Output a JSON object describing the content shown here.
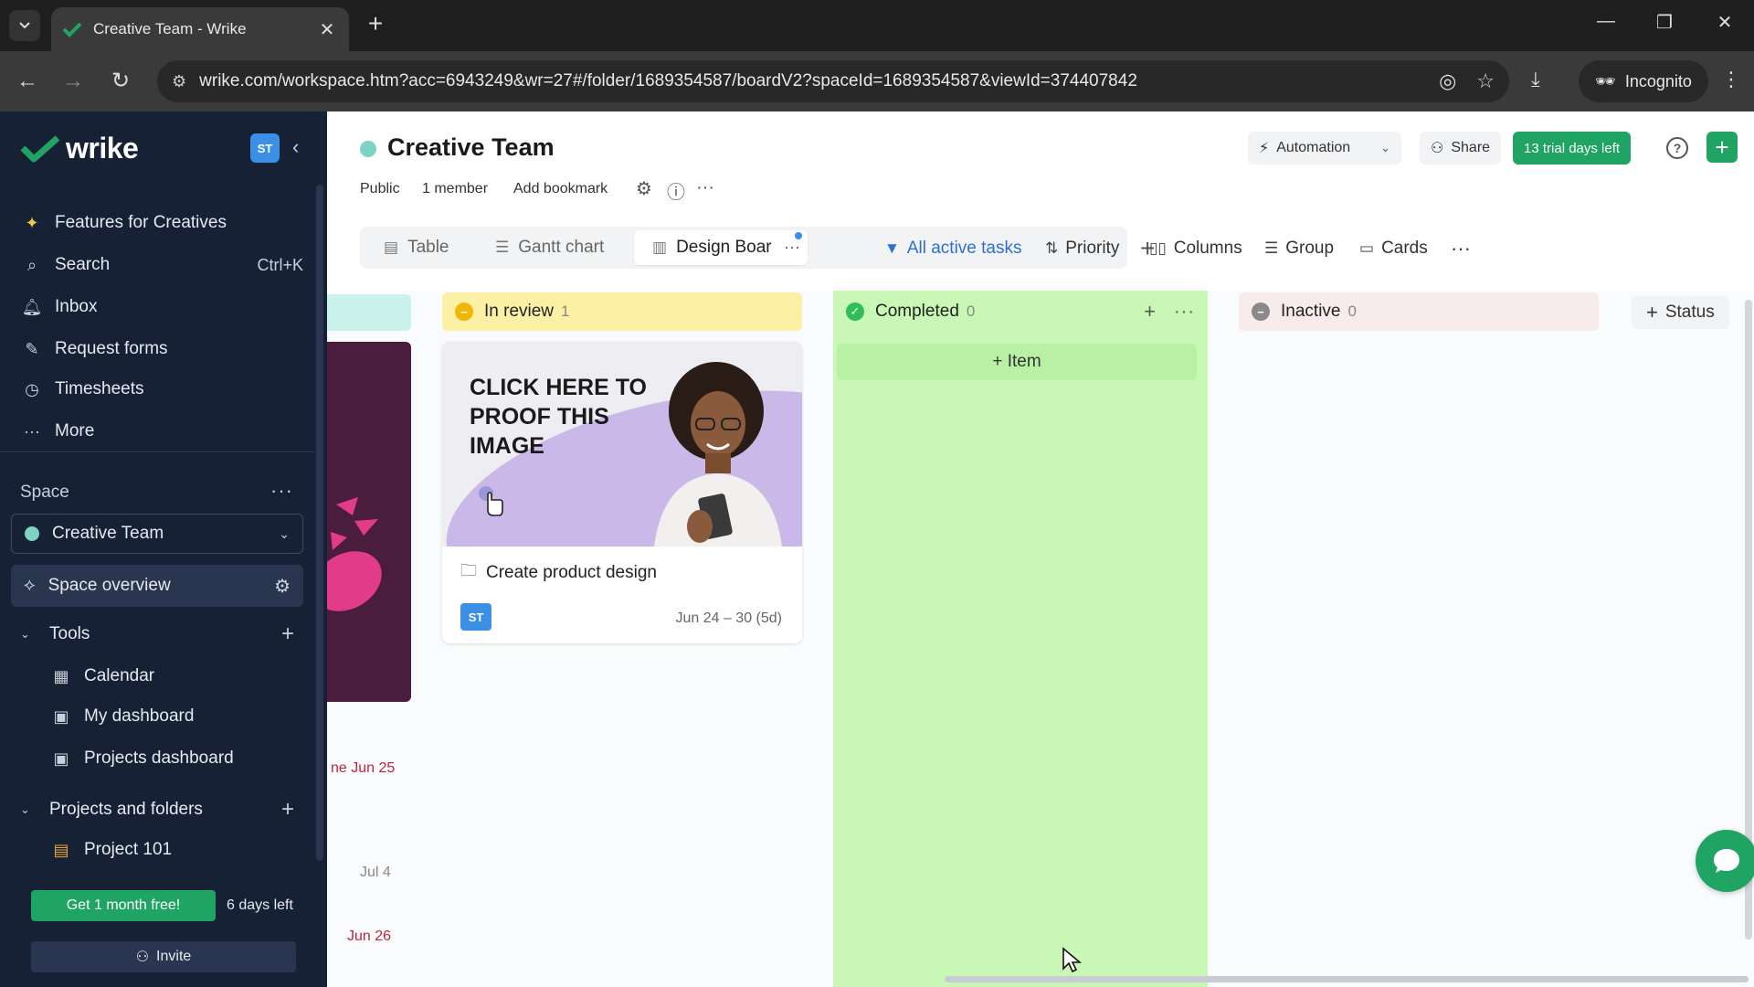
{
  "browser": {
    "tab_title": "Creative Team - Wrike",
    "url": "wrike.com/workspace.htm?acc=6943249&wr=27#/folder/1689354587/boardV2?spaceId=1689354587&viewId=374407842",
    "incognito_label": "Incognito"
  },
  "sidebar": {
    "logo_text": "wrike",
    "user_initials": "ST",
    "nav": [
      {
        "label": "Features for Creatives",
        "icon": "sparkle-icon"
      },
      {
        "label": "Search",
        "icon": "search-icon",
        "shortcut": "Ctrl+K"
      },
      {
        "label": "Inbox",
        "icon": "bell-icon"
      },
      {
        "label": "Request forms",
        "icon": "form-icon"
      },
      {
        "label": "Timesheets",
        "icon": "clock-icon"
      },
      {
        "label": "More",
        "icon": "more-icon"
      }
    ],
    "space_label": "Space",
    "space_selected": "Creative Team",
    "space_overview": "Space overview",
    "tools_label": "Tools",
    "tools": [
      {
        "label": "Calendar",
        "icon": "calendar-icon"
      },
      {
        "label": "My dashboard",
        "icon": "dashboard-icon"
      },
      {
        "label": "Projects dashboard",
        "icon": "dashboard-icon"
      }
    ],
    "projects_label": "Projects and folders",
    "projects": [
      {
        "label": "Project 101",
        "icon": "project-icon"
      }
    ],
    "promo_button": "Get 1 month free!",
    "days_left": "6 days left",
    "invite_label": "Invite"
  },
  "header": {
    "title": "Creative Team",
    "meta": [
      "Public",
      "1 member",
      "Add bookmark"
    ],
    "automation_label": "Automation",
    "share_label": "Share",
    "trial_label": "13 trial days left"
  },
  "views": {
    "tabs": [
      {
        "label": "Table",
        "icon": "table-icon"
      },
      {
        "label": "Gantt chart",
        "icon": "gantt-icon"
      },
      {
        "label": "Design Boar",
        "icon": "board-icon"
      }
    ]
  },
  "filters": {
    "active_tasks": "All active tasks",
    "priority": "Priority",
    "columns": "Columns",
    "group": "Group",
    "cards": "Cards"
  },
  "board": {
    "columns": [
      {
        "name": "In review",
        "count": "1",
        "color": "#fbf0a4",
        "icon_color": "#f2b705"
      },
      {
        "name": "Completed",
        "count": "0",
        "color": "#c9f7b5",
        "icon_color": "#2fbf57"
      },
      {
        "name": "Inactive",
        "count": "0",
        "color": "#f7eceb",
        "icon_color": "#8a8a8a"
      }
    ],
    "add_item_label": "+ Item",
    "add_status_label": "Status",
    "card": {
      "image_text": "CLICK HERE TO PROOF THIS IMAGE",
      "title": "Create product design",
      "assignee": "ST",
      "dates": "Jun 24 – 30 (5d)"
    },
    "left_column_dates": [
      {
        "label": "ne Jun 25",
        "color": "#c0243c"
      },
      {
        "label": "Jul 4",
        "color": "#888888"
      },
      {
        "label": "Jun 26",
        "color": "#c0243c"
      }
    ]
  },
  "colors": {
    "brand_green": "#1fa463",
    "sidebar_bg": "#172135",
    "accent_blue": "#2b6fd6"
  }
}
